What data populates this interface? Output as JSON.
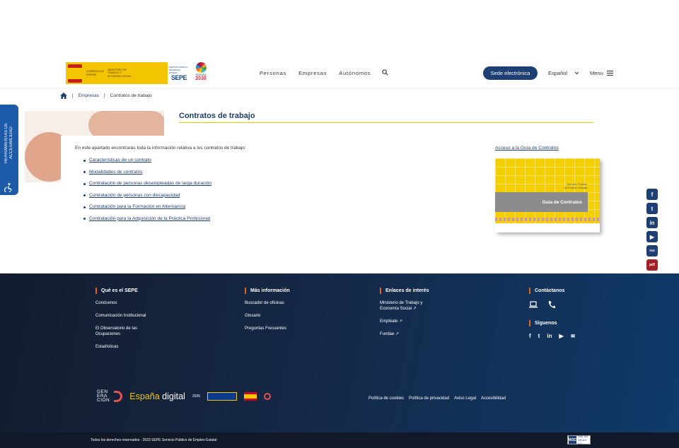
{
  "header": {
    "gov_logo": {
      "line1": "GOBIERNO DE ESPAÑA",
      "line2": "MINISTERIO DE TRABAJO Y ECONOMÍA SOCIAL"
    },
    "sepe_logo": {
      "small": "SERVICIO PÚBLICO DE EMPLEO ESTATAL",
      "big": "SEPE"
    },
    "agenda_logo": {
      "line1": "AGENDA",
      "line2": "2030"
    },
    "nav": [
      "Personas",
      "Empresas",
      "Autónomos"
    ],
    "sede_label": "Sede electrónica",
    "language": "Español",
    "menu_label": "Menu"
  },
  "breadcrumb": {
    "sep": "|",
    "items": [
      "Empresas",
      "Contratos de trabajo"
    ]
  },
  "accessibility_tab": {
    "line1": "HERRAMIENTAS DE",
    "line2": "ACCESIBILIDAD"
  },
  "main": {
    "title": "Contratos de trabajo",
    "intro": "En este apartado encontrarás toda la información relativa a los contratos de trabajo:",
    "links": [
      "Características de un contrato",
      "Modalidades de contratos",
      "Contratación de personas desempleadas de larga duración",
      "Contratación de personas con discapacidad",
      "Contratación para la Formación en Alternancia",
      "Contratación para la Adquisición de la Práctica Profesional"
    ],
    "guide_link": "Acceso a la Guía de Contratos",
    "guide_cover": {
      "subtitle1": "Servicio Público",
      "subtitle2": "de Empleo Estatal",
      "title": "Guía de Contratos"
    }
  },
  "social_sidebar": [
    "f",
    "t",
    "in",
    "▶",
    "rss",
    "pdf"
  ],
  "footer": {
    "col1": {
      "title": "Qué es el SEPE",
      "items": [
        "Conócenos",
        "Comunicación Institucional",
        "El Observatorio de las Ocupaciones",
        "Estadísticas"
      ]
    },
    "col2": {
      "title": "Más información",
      "items": [
        "Buscador de oficinas",
        "Glosario",
        "Preguntas Frecuentes"
      ]
    },
    "col3": {
      "title": "Enlaces de interés",
      "items": [
        "Ministerio de Trabajo y Economía Social",
        "Empléate",
        "Fundae"
      ]
    },
    "col4": {
      "title": "Contáctanos",
      "follow_title": "Síguenos"
    },
    "logos": {
      "gen": [
        "GEN",
        "ERA",
        "CIÓN"
      ],
      "espana": "España",
      "digital": "digital",
      "year": "2026"
    },
    "legal": [
      "Política de cookies",
      "Política de privacidad",
      "Aviso Legal",
      "Accesibilidad"
    ],
    "copyright": "Todos los dereches reservados - 2023 SEPE Servicio Público de Empleo Estatal",
    "wai": {
      "mark": "W3C",
      "line1": "WAI-AA",
      "line2": "WCAG 2.1"
    }
  }
}
